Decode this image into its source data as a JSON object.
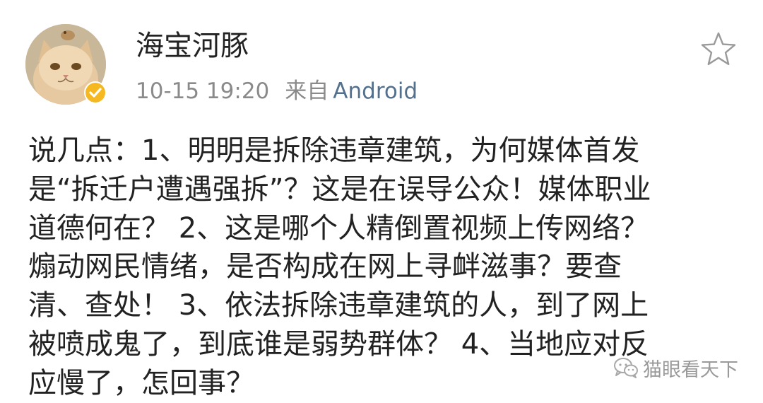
{
  "post": {
    "username": "海宝河豚",
    "timestamp": "10-15 19:20",
    "source_prefix": "来自",
    "source_app": "Android",
    "avatar_icon": "cat-avatar",
    "verified_icon": "verified-badge-icon",
    "favorite_icon": "star-outline-icon",
    "content_lines": [
      "说几点：1、明明是拆除违章建筑，为何媒体首发",
      "是“拆迁户遭遇强拆”？这是在误导公众！媒体职业",
      "道德何在？ 2、这是哪个人精倒置视频上传网络？",
      "煽动网民情绪，是否构成在网上寻衅滋事？要查",
      "清、查处！ 3、依法拆除违章建筑的人，到了网上",
      "被喷成鬼了，到底谁是弱势群体？ 4、当地应对反",
      "应慢了，怎回事？"
    ]
  },
  "watermark": {
    "icon": "wechat-icon",
    "text": "猫眼看天下"
  },
  "colors": {
    "text": "#222222",
    "meta": "#8a8a8a",
    "source_link": "#53708c",
    "badge": "#f5b821",
    "star_outline": "#999999"
  }
}
